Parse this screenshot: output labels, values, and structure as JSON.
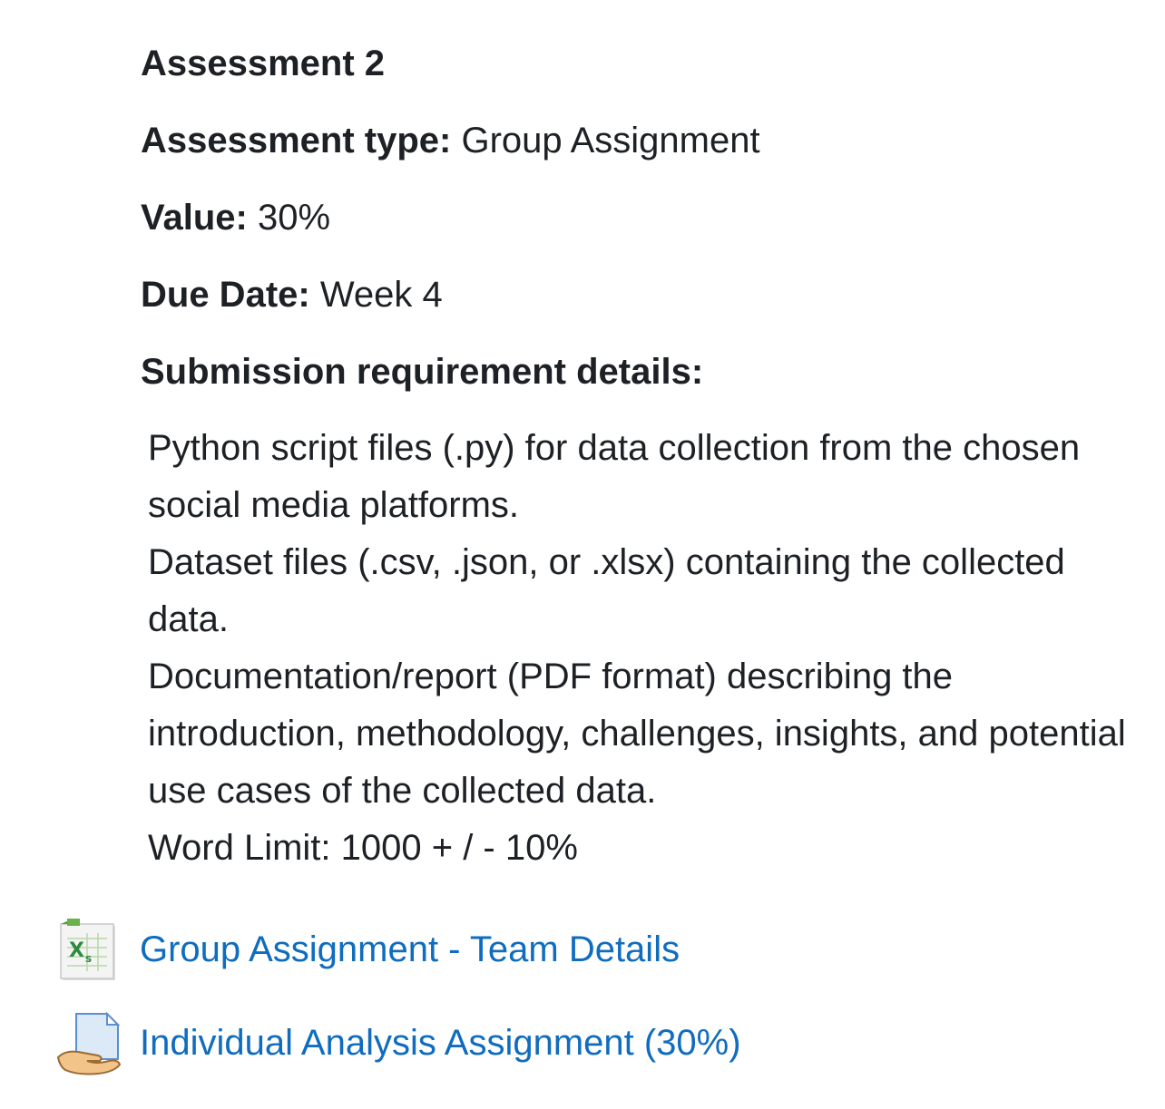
{
  "assessment": {
    "title": "Assessment 2",
    "type_label": "Assessment type:",
    "type_value": " Group Assignment",
    "value_label": "Value:",
    "value_value": " 30%",
    "due_label": "Due Date:",
    "due_value": " Week 4",
    "requirements_title": "Submission requirement details:",
    "requirements": [
      "Python script files (.py) for data collection from the chosen social media platforms.",
      "Dataset files (.csv, .json, or .xlsx) containing the collected data.",
      "Documentation/report (PDF format) describing the introduction, methodology, challenges, insights, and potential use cases of the collected data.",
      "Word Limit: 1000 + / - 10%"
    ]
  },
  "resources": [
    {
      "label": "Group Assignment - Team Details",
      "icon": "spreadsheet-icon"
    },
    {
      "label": "Individual Analysis Assignment (30%)",
      "icon": "assignment-submit-icon"
    }
  ],
  "colors": {
    "link": "#0f6cbf",
    "text": "#1d2125"
  }
}
